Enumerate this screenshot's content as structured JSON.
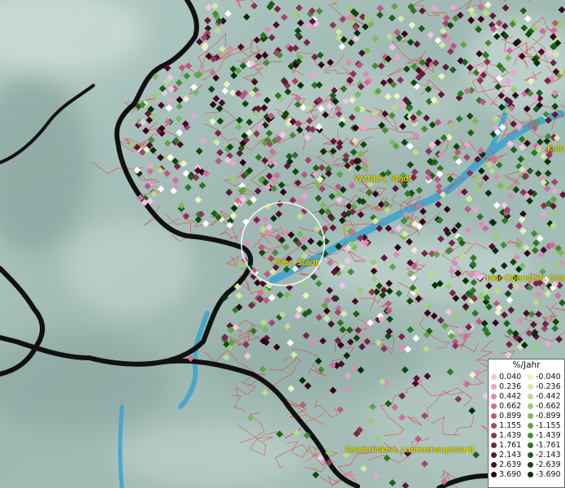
{
  "map": {
    "cities": [
      {
        "id": "wittlich",
        "label": "Wittlich, Stadt"
      },
      {
        "id": "trier",
        "label": "Trier, Stadt"
      },
      {
        "id": "idar",
        "label": "Idar-Oberstein, Stad"
      },
      {
        "id": "kaiserslautern",
        "label": "Kais"
      },
      {
        "id": "saarbruecken",
        "label": "Saarbrücken, Landeshauptstadt"
      }
    ]
  },
  "legend": {
    "title": "%/Jahr",
    "rows": [
      {
        "pos": "0.040",
        "pos_color": "#f4c3e3",
        "neg": "-0.040",
        "neg_color": "#e9f2c5"
      },
      {
        "pos": "0.236",
        "pos_color": "#e8a6cd",
        "neg": "-0.236",
        "neg_color": "#d4e8a8"
      },
      {
        "pos": "0.442",
        "pos_color": "#dc8db7",
        "neg": "-0.442",
        "neg_color": "#bcdb8c"
      },
      {
        "pos": "0.662",
        "pos_color": "#cc6f9b",
        "neg": "-0.662",
        "neg_color": "#9ccb72"
      },
      {
        "pos": "0.899",
        "pos_color": "#b85a84",
        "neg": "-0.899",
        "neg_color": "#7db85c"
      },
      {
        "pos": "1.155",
        "pos_color": "#a2456d",
        "neg": "-1.155",
        "neg_color": "#5fa347"
      },
      {
        "pos": "1.439",
        "pos_color": "#8c3458",
        "neg": "-1.439",
        "neg_color": "#468c35"
      },
      {
        "pos": "1.761",
        "pos_color": "#762447",
        "neg": "-1.761",
        "neg_color": "#2f7625"
      },
      {
        "pos": "2.143",
        "pos_color": "#601638",
        "neg": "-2.143",
        "neg_color": "#1c5f18"
      },
      {
        "pos": "2.639",
        "pos_color": "#4a0c29",
        "neg": "-2.639",
        "neg_color": "#0e480d"
      },
      {
        "pos": "3.690",
        "pos_color": "#33041a",
        "neg": "-3.690",
        "neg_color": "#053006"
      }
    ]
  }
}
